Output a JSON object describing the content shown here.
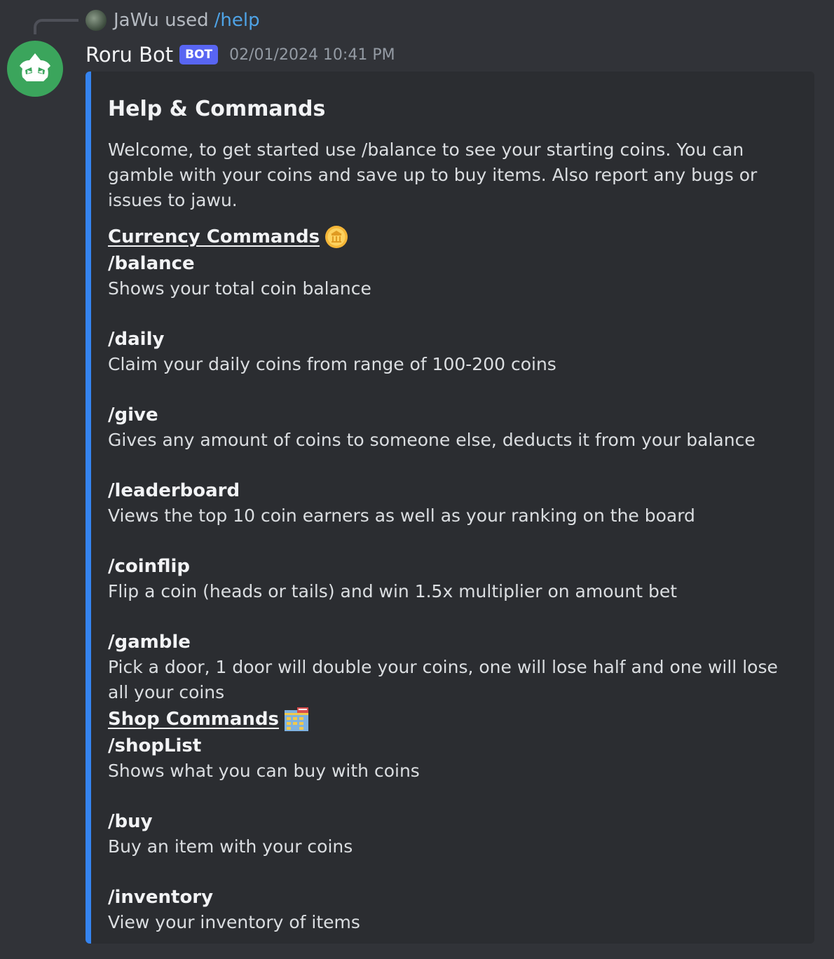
{
  "reply": {
    "user_text": "JaWu used",
    "command": "/help",
    "avatar_icon": "user-avatar-thumbnail"
  },
  "author": {
    "name": "Roru Bot",
    "tag": "BOT",
    "timestamp": "02/01/2024 10:41 PM",
    "avatar_icon": "discord-bot-avatar",
    "avatar_color": "#3ba55c"
  },
  "embed": {
    "accent_color": "#3584f0",
    "title": "Help & Commands",
    "description": "Welcome, to get started use /balance to see your starting coins. You can gamble with your coins and save up to buy items. Also report any bugs or issues to jawu.",
    "sections": [
      {
        "heading": "Currency Commands",
        "emoji": "coin-icon",
        "commands": [
          {
            "name": "/balance",
            "desc": "Shows your total coin balance"
          },
          {
            "name": "/daily",
            "desc": "Claim your daily coins from range of 100-200 coins"
          },
          {
            "name": "/give",
            "desc": "Gives any amount of coins to someone else, deducts it from your balance"
          },
          {
            "name": "/leaderboard",
            "desc": "Views the top 10 coin earners as well as your ranking on the board"
          },
          {
            "name": "/coinflip",
            "desc": "Flip a coin (heads or tails) and win 1.5x multiplier on amount bet"
          },
          {
            "name": "/gamble",
            "desc": "Pick a door, 1 door will double your coins, one will lose half and one will lose all your coins"
          }
        ]
      },
      {
        "heading": "Shop Commands",
        "emoji": "department-store-icon",
        "commands": [
          {
            "name": "/shopList",
            "desc": "Shows what you can buy with coins"
          },
          {
            "name": "/buy",
            "desc": "Buy an item with your coins"
          },
          {
            "name": "/inventory",
            "desc": "View your inventory of items"
          }
        ]
      }
    ]
  }
}
